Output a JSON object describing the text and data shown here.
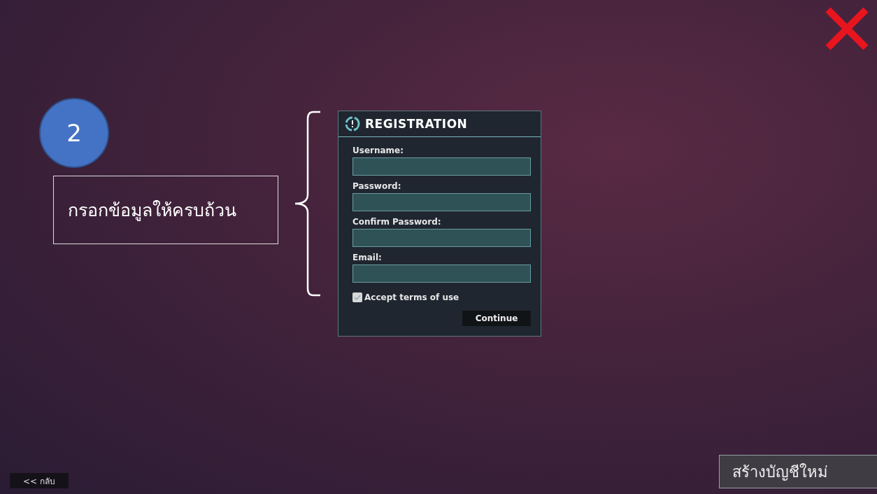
{
  "step": {
    "number": "2",
    "caption": "กรอกข้อมูลให้ครบถ้วน"
  },
  "registration": {
    "title": "REGISTRATION",
    "fields": [
      {
        "label": "Username:"
      },
      {
        "label": "Password:"
      },
      {
        "label": "Confirm Password:"
      },
      {
        "label": "Email:"
      }
    ],
    "terms": {
      "label": "Accept terms of use",
      "checked": true
    },
    "submit": "Continue"
  },
  "back_button": "<< กลับ",
  "create_account_button": "สร้างบัญชีใหม่"
}
